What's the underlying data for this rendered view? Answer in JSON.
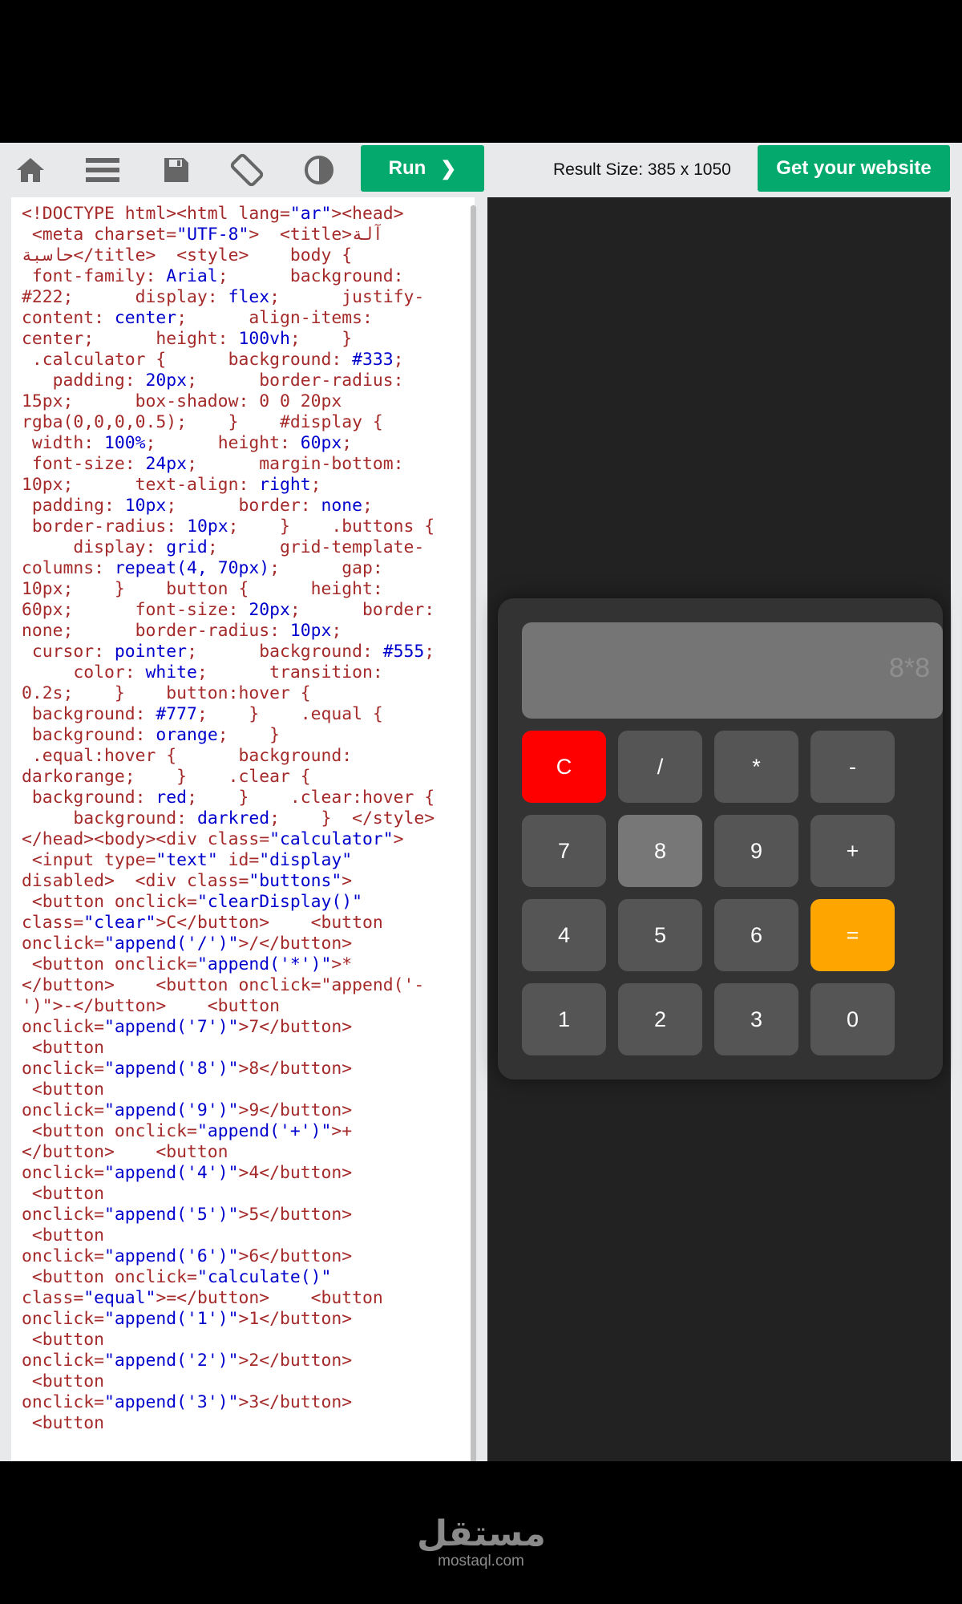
{
  "toolbar": {
    "icons": [
      "home-icon",
      "menu-icon",
      "save-icon",
      "rotate-icon",
      "contrast-icon"
    ],
    "run_label": "Run",
    "run_chevron": "❯",
    "result_size": "Result Size: 385 x 1050",
    "get_website_label": "Get your website"
  },
  "code_lines": [
    "<!DOCTYPE html><html lang=\"ar\"><head>",
    " <meta charset=\"UTF-8\">  <title>آلة",
    "حاسبة</title>  <style>    body {",
    " font-family: Arial;      background:",
    "#222;      display: flex;      justify-",
    "content: center;      align-items:",
    "center;      height: 100vh;    }",
    " .calculator {      background: #333;",
    "   padding: 20px;      border-radius:",
    "15px;      box-shadow: 0 0 20px",
    "rgba(0,0,0,0.5);    }    #display {",
    " width: 100%;      height: 60px;",
    " font-size: 24px;      margin-bottom:",
    "10px;      text-align: right;",
    " padding: 10px;      border: none;",
    " border-radius: 10px;    }    .buttons {",
    "     display: grid;      grid-template-",
    "columns: repeat(4, 70px);      gap:",
    "10px;    }    button {      height:",
    "60px;      font-size: 20px;      border:",
    "none;      border-radius: 10px;",
    " cursor: pointer;      background: #555;",
    "     color: white;      transition:",
    "0.2s;    }    button:hover {",
    " background: #777;    }    .equal {",
    " background: orange;    }",
    " .equal:hover {      background:",
    "darkorange;    }    .clear {",
    " background: red;    }    .clear:hover {",
    "     background: darkred;    }  </style>",
    "</head><body><div class=\"calculator\">",
    " <input type=\"text\" id=\"display\"",
    "disabled>  <div class=\"buttons\">",
    " <button onclick=\"clearDisplay()\"",
    "class=\"clear\">C</button>    <button",
    "onclick=\"append('/')\">/</button>",
    " <button onclick=\"append('*')\">*",
    "</button>    <button onclick=\"append('-",
    "')\">-</button>    <button",
    "onclick=\"append('7')\">7</button>",
    " <button",
    "onclick=\"append('8')\">8</button>",
    " <button",
    "onclick=\"append('9')\">9</button>",
    " <button onclick=\"append('+')\">+",
    "</button>    <button",
    "onclick=\"append('4')\">4</button>",
    " <button",
    "onclick=\"append('5')\">5</button>",
    " <button",
    "onclick=\"append('6')\">6</button>",
    " <button onclick=\"calculate()\"",
    "class=\"equal\">=</button>    <button",
    "onclick=\"append('1')\">1</button>",
    " <button",
    "onclick=\"append('2')\">2</button>",
    " <button",
    "onclick=\"append('3')\">3</button>",
    " <button"
  ],
  "calculator": {
    "display_value": "8*8",
    "keys": [
      {
        "label": "C",
        "type": "clear"
      },
      {
        "label": "/",
        "type": "normal"
      },
      {
        "label": "*",
        "type": "normal"
      },
      {
        "label": "-",
        "type": "normal"
      },
      {
        "label": "7",
        "type": "normal"
      },
      {
        "label": "8",
        "type": "hover"
      },
      {
        "label": "9",
        "type": "normal"
      },
      {
        "label": "+",
        "type": "normal"
      },
      {
        "label": "4",
        "type": "normal"
      },
      {
        "label": "5",
        "type": "normal"
      },
      {
        "label": "6",
        "type": "normal"
      },
      {
        "label": "=",
        "type": "equal"
      },
      {
        "label": "1",
        "type": "normal"
      },
      {
        "label": "2",
        "type": "normal"
      },
      {
        "label": "3",
        "type": "normal"
      },
      {
        "label": "0",
        "type": "normal"
      }
    ],
    "colors": {
      "clear": "#ff0000",
      "equal": "#ffa500",
      "key": "#555555",
      "hover": "#777777",
      "body": "#333333",
      "page": "#222222"
    }
  },
  "footer": {
    "logo_ar": "مستقل",
    "logo_en": "mostaql.com"
  }
}
